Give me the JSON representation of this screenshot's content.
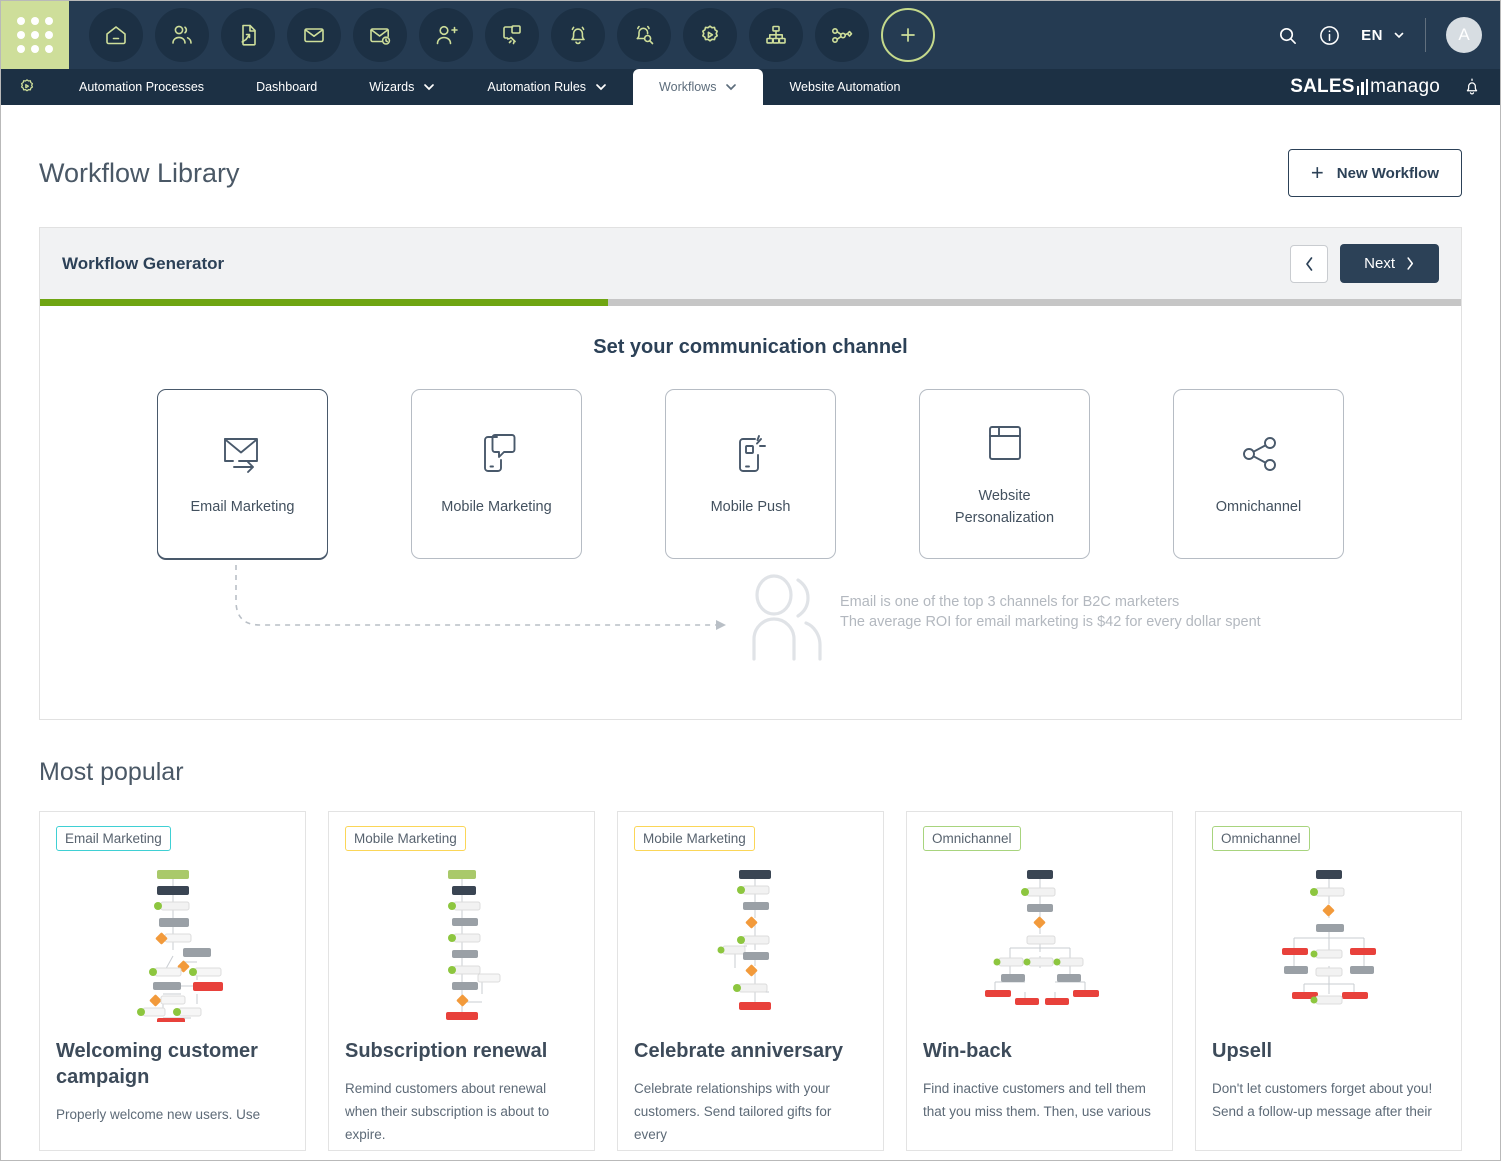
{
  "topbar": {
    "launcher": "apps-grid-icon",
    "icons": [
      {
        "name": "home-icon",
        "title": "Home"
      },
      {
        "name": "contacts-icon",
        "title": "Contacts"
      },
      {
        "name": "document-export-icon",
        "title": "Reports"
      },
      {
        "name": "email-icon",
        "title": "Email"
      },
      {
        "name": "email-schedule-icon",
        "title": "Scheduled Email"
      },
      {
        "name": "add-user-icon",
        "title": "Add Contact"
      },
      {
        "name": "web-push-icon",
        "title": "Web Push"
      },
      {
        "name": "bell-icon",
        "title": "Alerts"
      },
      {
        "name": "bell-search-icon",
        "title": "Alert Monitoring"
      },
      {
        "name": "automation-gear-icon",
        "title": "Automation"
      },
      {
        "name": "sitemap-icon",
        "title": "Structure"
      },
      {
        "name": "workflow-node-icon",
        "title": "Workflows"
      }
    ],
    "add_button": "+",
    "search_icon": "search-icon",
    "info_icon": "info-icon",
    "language": "EN",
    "avatar_initial": "A"
  },
  "navbar": {
    "gear_icon": "automation-gear-icon",
    "items": [
      {
        "label": "Automation Processes",
        "caret": false,
        "active": false
      },
      {
        "label": "Dashboard",
        "caret": false,
        "active": false
      },
      {
        "label": "Wizards",
        "caret": true,
        "active": false
      },
      {
        "label": "Automation Rules",
        "caret": true,
        "active": false
      },
      {
        "label": "Workflows",
        "caret": true,
        "active": true
      },
      {
        "label": "Website Automation",
        "caret": false,
        "active": false
      }
    ],
    "brand_left": "SALES",
    "brand_right": "manago",
    "notification_icon": "bell-icon"
  },
  "page": {
    "title": "Workflow Library",
    "new_workflow_label": "New Workflow",
    "new_workflow_plus": "+"
  },
  "generator": {
    "title": "Workflow Generator",
    "prev_label": "‹",
    "next_label": "Next",
    "next_caret": "›",
    "progress_percent": 40,
    "heading": "Set your communication channel",
    "channels": [
      {
        "label": "Email Marketing",
        "icon": "envelope-arrow-icon",
        "selected": true
      },
      {
        "label": "Mobile Marketing",
        "icon": "mobile-chat-icon",
        "selected": false
      },
      {
        "label": "Mobile Push",
        "icon": "mobile-push-icon",
        "selected": false
      },
      {
        "label": "Website\nPersonalization",
        "icon": "browser-window-icon",
        "selected": false
      },
      {
        "label": "Omnichannel",
        "icon": "share-nodes-icon",
        "selected": false
      }
    ],
    "tip_line_1": "Email is one of the top 3 channels for B2C marketers",
    "tip_line_2": "The average ROI for email marketing is $42 for every dollar spent",
    "tip_icon": "people-icon"
  },
  "popular": {
    "heading": "Most popular",
    "cards": [
      {
        "badge": "Email Marketing",
        "badge_type": "email",
        "title": "Welcoming customer campaign",
        "desc": "Properly welcome new users. Use",
        "thumb": "workflow-diagram-thumbnail"
      },
      {
        "badge": "Mobile Marketing",
        "badge_type": "mobile",
        "title": "Subscription renewal",
        "desc": "Remind customers about renewal when their subscription is about to expire.",
        "thumb": "workflow-diagram-thumbnail"
      },
      {
        "badge": "Mobile Marketing",
        "badge_type": "mobile",
        "title": "Celebrate anniversary",
        "desc": "Celebrate relationships with your customers. Send tailored gifts for every",
        "thumb": "workflow-diagram-thumbnail"
      },
      {
        "badge": "Omnichannel",
        "badge_type": "omni",
        "title": "Win-back",
        "desc": "Find inactive customers and tell them that you miss them. Then, use various",
        "thumb": "workflow-diagram-thumbnail"
      },
      {
        "badge": "Omnichannel",
        "badge_type": "omni",
        "title": "Upsell",
        "desc": "Don't let customers forget about you! Send a follow-up message after their",
        "thumb": "workflow-diagram-thumbnail"
      }
    ]
  },
  "colors": {
    "topbar_bg": "#253b52",
    "navbar_bg": "#1c3044",
    "launcher_green": "#cede9a",
    "progress_green": "#6fa512",
    "accent_dark": "#2c4157",
    "badge_email": "#3fd0d4",
    "badge_mobile": "#fbd658",
    "badge_omni": "#a8d47e"
  }
}
